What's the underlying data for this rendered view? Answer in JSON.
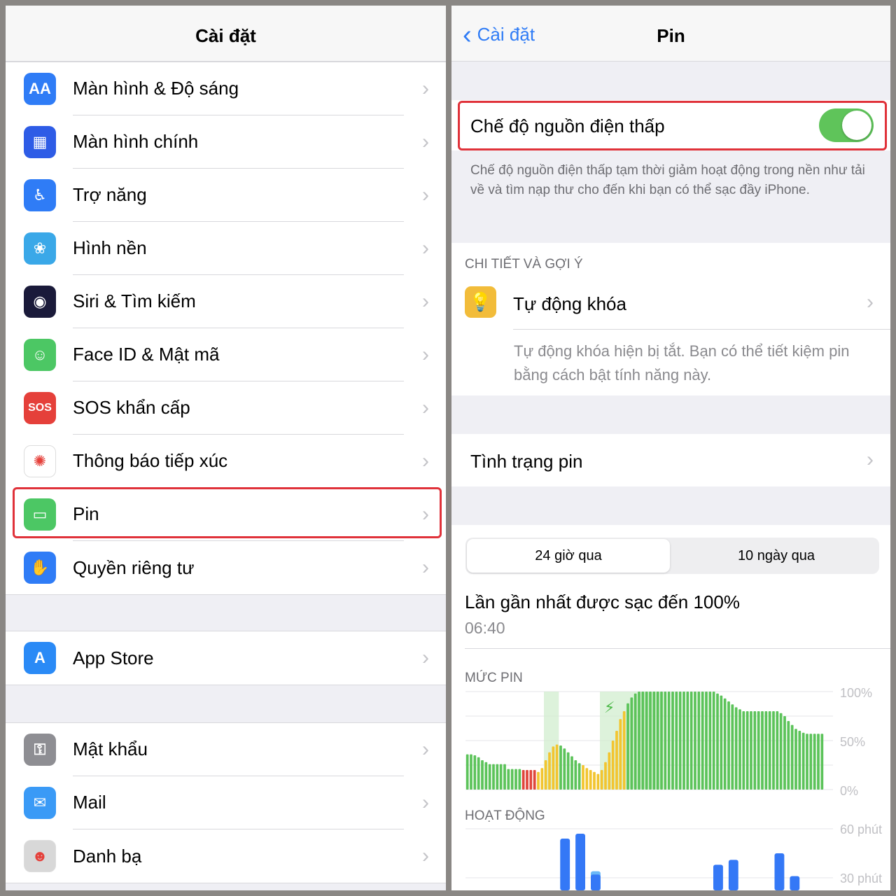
{
  "left": {
    "title": "Cài đặt",
    "groups": [
      [
        {
          "label": "Màn hình & Độ sáng",
          "icon": "display-brightness-icon",
          "color": "#2f7cf6",
          "glyph": "AA"
        },
        {
          "label": "Màn hình chính",
          "icon": "home-screen-icon",
          "color": "#2e5ce6",
          "glyph": "▦"
        },
        {
          "label": "Trợ năng",
          "icon": "accessibility-icon",
          "color": "#2f7cf6",
          "glyph": "♿"
        },
        {
          "label": "Hình nền",
          "icon": "wallpaper-icon",
          "color": "#3aa8e8",
          "glyph": "❀"
        },
        {
          "label": "Siri & Tìm kiếm",
          "icon": "siri-icon",
          "color": "#1a1a3a",
          "glyph": "◉"
        },
        {
          "label": "Face ID & Mật mã",
          "icon": "face-id-icon",
          "color": "#4cc764",
          "glyph": "☺"
        },
        {
          "label": "SOS khẩn cấp",
          "icon": "sos-icon",
          "color": "#e5403a",
          "glyph": "SOS"
        },
        {
          "label": "Thông báo tiếp xúc",
          "icon": "exposure-notification-icon",
          "color": "#ffffff",
          "glyph": "✺"
        },
        {
          "label": "Pin",
          "icon": "battery-icon",
          "color": "#4cc764",
          "glyph": "▭"
        },
        {
          "label": "Quyền riêng tư",
          "icon": "privacy-hand-icon",
          "color": "#2f7cf6",
          "glyph": "✋"
        }
      ],
      [
        {
          "label": "App Store",
          "icon": "app-store-icon",
          "color": "#2a8af6",
          "glyph": "A"
        }
      ],
      [
        {
          "label": "Mật khẩu",
          "icon": "passwords-key-icon",
          "color": "#8e8e93",
          "glyph": "⚿"
        },
        {
          "label": "Mail",
          "icon": "mail-icon",
          "color": "#3a9af6",
          "glyph": "✉"
        },
        {
          "label": "Danh bạ",
          "icon": "contacts-icon",
          "color": "#d8d8d8",
          "glyph": "☻"
        }
      ]
    ]
  },
  "right": {
    "back": "Cài đặt",
    "title": "Pin",
    "low_power": {
      "label": "Chế độ nguồn điện thấp",
      "on": true,
      "footer": "Chế độ nguồn điện thấp tạm thời giảm hoạt động trong nền như tải về và tìm nạp thư cho đến khi bạn có thể sạc đầy iPhone."
    },
    "insights_header": "CHI TIẾT VÀ GỢI Ý",
    "auto_lock": {
      "label": "Tự động khóa",
      "desc": "Tự động khóa hiện bị tắt. Bạn có thể tiết kiệm pin bằng cách bật tính năng này."
    },
    "battery_health": "Tình trạng pin",
    "tabs": [
      "24 giờ qua",
      "10 ngày qua"
    ],
    "last_charged_label": "Lần gần nhất được sạc đến 100%",
    "last_charged_time": "06:40"
  },
  "chart_data": [
    {
      "type": "bar",
      "title": "MỨC PIN",
      "y_ticks": [
        "100%",
        "50%",
        "0%"
      ],
      "ylim": [
        0,
        100
      ],
      "grid": true,
      "values": [
        36,
        36,
        35,
        33,
        30,
        28,
        26,
        26,
        26,
        26,
        26,
        21,
        21,
        21,
        21,
        20,
        20,
        20,
        20,
        18,
        22,
        30,
        38,
        44,
        46,
        45,
        42,
        38,
        34,
        30,
        27,
        25,
        22,
        20,
        18,
        16,
        20,
        28,
        38,
        50,
        60,
        72,
        80,
        88,
        94,
        98,
        100,
        100,
        100,
        100,
        100,
        100,
        100,
        100,
        100,
        100,
        100,
        100,
        100,
        100,
        100,
        100,
        100,
        100,
        100,
        100,
        100,
        98,
        96,
        93,
        90,
        87,
        84,
        82,
        80,
        80,
        80,
        80,
        80,
        80,
        80,
        80,
        80,
        80,
        78,
        75,
        70,
        66,
        62,
        60,
        58,
        57,
        57,
        57,
        57,
        57
      ],
      "color_ranges": [
        {
          "from": 0,
          "to": 14,
          "color": "#5cc35a"
        },
        {
          "from": 15,
          "to": 18,
          "color": "#e0463c"
        },
        {
          "from": 19,
          "to": 24,
          "color": "#f2c530"
        },
        {
          "from": 25,
          "to": 30,
          "color": "#5cc35a"
        },
        {
          "from": 31,
          "to": 42,
          "color": "#f2c530"
        },
        {
          "from": 43,
          "to": 95,
          "color": "#5cc35a"
        }
      ],
      "charging_ranges": [
        {
          "from": 21,
          "to": 24
        },
        {
          "from": 36,
          "to": 52
        }
      ]
    },
    {
      "type": "bar",
      "title": "HOẠT ĐỘNG",
      "y_ticks": [
        "60 phút",
        "30 phút"
      ],
      "ylim": [
        0,
        60
      ],
      "grid": true,
      "hours": [
        6,
        7,
        8,
        16,
        17,
        20,
        21
      ],
      "screen_on": [
        54,
        57,
        32,
        38,
        41,
        45,
        31
      ],
      "screen_off": [
        0,
        0,
        2,
        0,
        0,
        0,
        0
      ],
      "colors": {
        "screen_on": "#3478f6",
        "screen_off": "#6ab8f7"
      }
    }
  ]
}
